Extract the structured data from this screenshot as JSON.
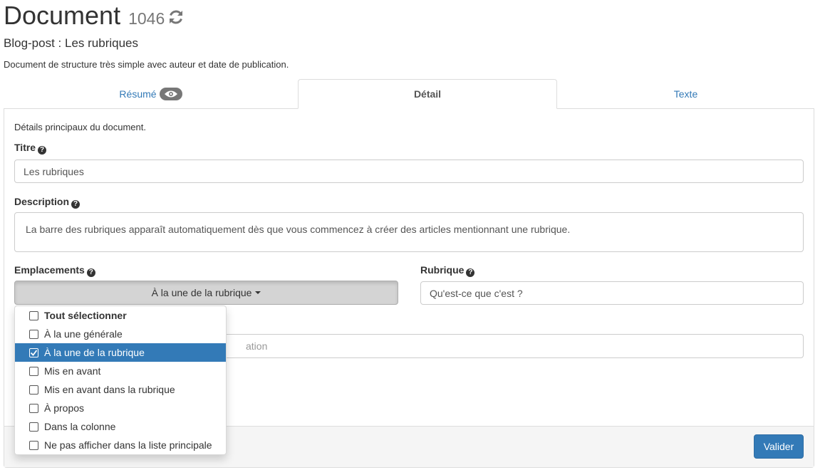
{
  "header": {
    "title": "Document",
    "doc_number": "1046",
    "subtitle": "Blog-post : Les rubriques",
    "lead": "Document de structure très simple avec auteur et date de publication."
  },
  "tabs": [
    {
      "label": "Résumé",
      "active": false
    },
    {
      "label": "Détail",
      "active": true
    },
    {
      "label": "Texte",
      "active": false
    }
  ],
  "form": {
    "intro": "Détails principaux du document.",
    "titre": {
      "label": "Titre",
      "value": "Les rubriques"
    },
    "description": {
      "label": "Description",
      "value": "La barre des rubriques apparaît automatiquement dès que vous commencez à créer des articles mentionnant une rubrique."
    },
    "emplacements": {
      "label": "Emplacements",
      "selected": "À la une de la rubrique",
      "options": [
        {
          "label": "Tout sélectionner",
          "checked": false
        },
        {
          "label": "À la une générale",
          "checked": false
        },
        {
          "label": "À la une de la rubrique",
          "checked": true
        },
        {
          "label": "Mis en avant",
          "checked": false
        },
        {
          "label": "Mis en avant dans la rubrique",
          "checked": false
        },
        {
          "label": "À propos",
          "checked": false
        },
        {
          "label": "Dans la colonne",
          "checked": false
        },
        {
          "label": "Ne pas afficher dans la liste principale",
          "checked": false
        }
      ]
    },
    "rubrique": {
      "label": "Rubrique",
      "value": "Qu'est-ce que c'est ?"
    },
    "hidden_field": {
      "placeholder_fragment": "ation"
    }
  },
  "footer": {
    "submit_label": "Valider"
  },
  "colors": {
    "primary": "#337ab7",
    "badge": "#777777",
    "footer_bg": "#f5f5f5"
  }
}
